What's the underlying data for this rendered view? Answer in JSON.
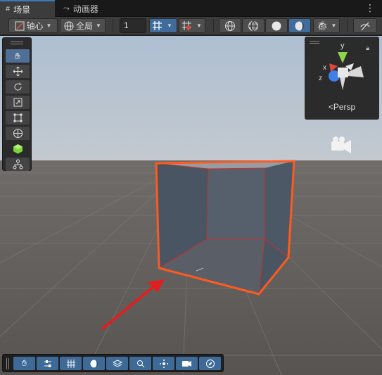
{
  "tabs": [
    {
      "label": "场景",
      "icon": "hash-icon",
      "active": true
    },
    {
      "label": "动画器",
      "icon": "animator-icon",
      "active": false
    }
  ],
  "toolbar": {
    "pivot_label": "轴心",
    "global_label": "全局",
    "grid_value": "1"
  },
  "gizmo": {
    "projection_label": "Persp",
    "axis_x": "x",
    "axis_y": "y",
    "axis_z": "z"
  },
  "colors": {
    "selection_outline": "#ff5a1f",
    "arrow": "#e02020",
    "accent_blue": "#3f6c9a",
    "axis_x": "#e0443a",
    "axis_y": "#8bd34a",
    "axis_z": "#3f7ee8"
  },
  "tools": [
    "hand-tool",
    "move-tool",
    "rotate-tool",
    "scale-tool",
    "rect-tool",
    "transform-tool",
    "custom-tool",
    "hierarchy-tool"
  ],
  "overlay_tools": [
    "hand",
    "sliders",
    "grid",
    "shading",
    "layers",
    "search",
    "pivot",
    "camera",
    "compass"
  ]
}
